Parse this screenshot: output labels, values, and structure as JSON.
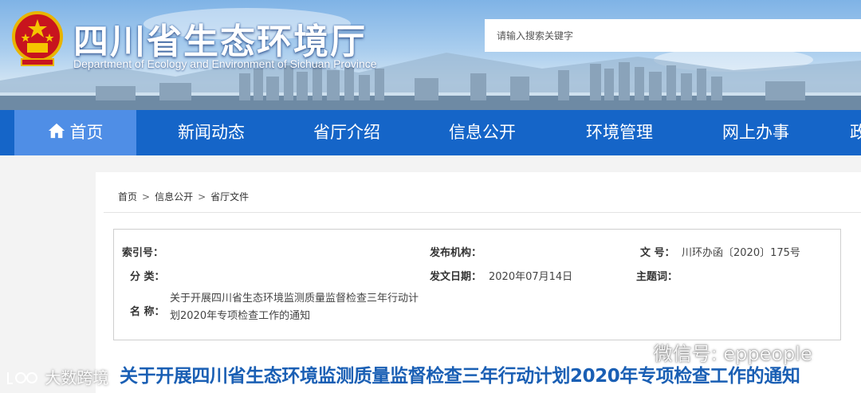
{
  "header": {
    "title": "四川省生态环境厅",
    "subtitle": "Department of Ecology and Environment of Sichuan Province",
    "search_placeholder": "请输入搜索关键字"
  },
  "nav": {
    "items": [
      {
        "label": "首页",
        "icon": "home-icon",
        "active": true
      },
      {
        "label": "新闻动态"
      },
      {
        "label": "省厅介绍"
      },
      {
        "label": "信息公开"
      },
      {
        "label": "环境管理"
      },
      {
        "label": "网上办事"
      },
      {
        "label": "政"
      }
    ]
  },
  "breadcrumb": {
    "items": [
      "首页",
      "信息公开",
      "省厅文件"
    ],
    "separator": ">"
  },
  "meta": {
    "index_label": "索引号：",
    "index_value": "",
    "publisher_label": "发布机构：",
    "publisher_value": "",
    "docno_label": "文 号：",
    "docno_value": "川环办函〔2020〕175号",
    "category_label": "分 类：",
    "category_value": "",
    "date_label": "发文日期：",
    "date_value": "2020年07月14日",
    "subject_label": "主题词：",
    "subject_value": "",
    "name_label": "名 称：",
    "name_value": "关于开展四川省生态环境监测质量监督检查三年行动计划2020年专项检查工作的通知"
  },
  "article": {
    "title": "关于开展四川省生态环境监测质量监督检查三年行动计划2020年专项检查工作的通知"
  },
  "watermarks": {
    "wechat": "微信号: eppeople",
    "left": "大数跨境"
  },
  "colors": {
    "nav_bg": "#1565c8",
    "nav_active": "#4f8ee6",
    "title_blue": "#1a5fb4"
  }
}
